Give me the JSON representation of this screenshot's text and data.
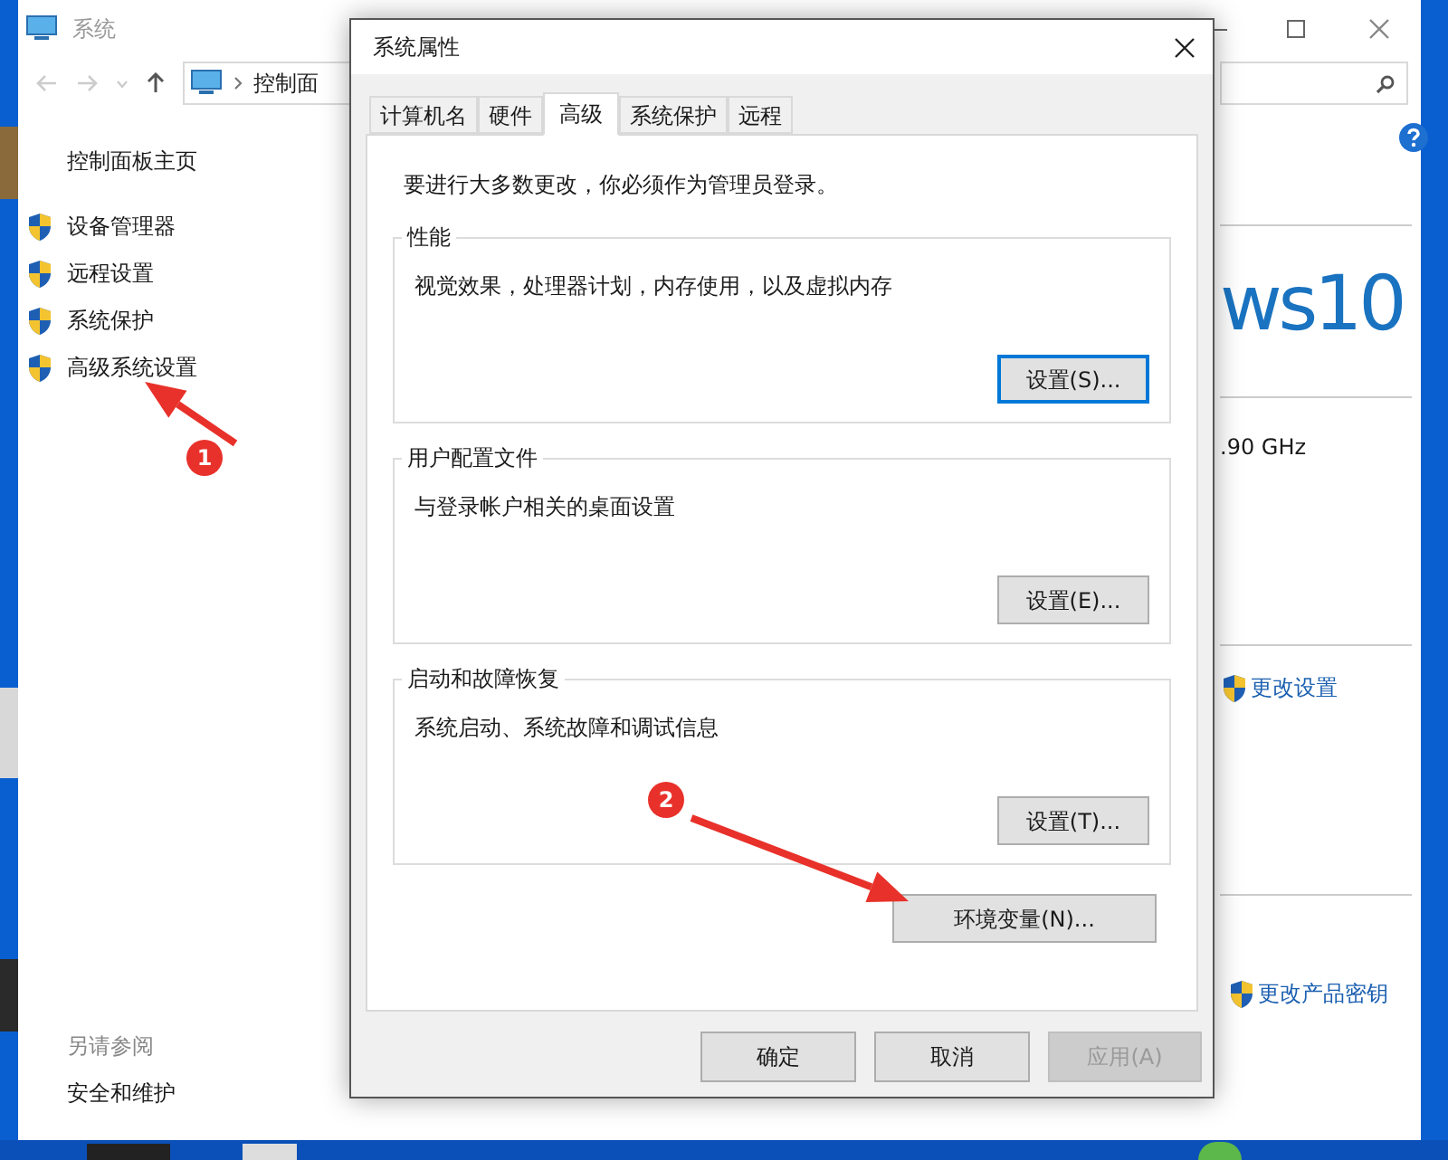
{
  "system_window": {
    "title": "系统",
    "breadcrumb": "控制面",
    "sidebar": {
      "home": "控制面板主页",
      "items": [
        {
          "label": "设备管理器"
        },
        {
          "label": "远程设置"
        },
        {
          "label": "系统保护"
        },
        {
          "label": "高级系统设置"
        }
      ],
      "see_also_title": "另请参阅",
      "see_also": [
        "安全和维护"
      ]
    },
    "edition_logo": "ws10",
    "processor_speed": ".90 GHz",
    "links": [
      {
        "label": "更改设置"
      },
      {
        "label": "更改产品密钥"
      }
    ]
  },
  "dialog": {
    "title": "系统属性",
    "tabs": [
      {
        "label": "计算机名",
        "selected": false
      },
      {
        "label": "硬件",
        "selected": false
      },
      {
        "label": "高级",
        "selected": true
      },
      {
        "label": "系统保护",
        "selected": false
      },
      {
        "label": "远程",
        "selected": false
      }
    ],
    "admin_note": "要进行大多数更改，你必须作为管理员登录。",
    "groups": [
      {
        "title": "性能",
        "description": "视觉效果，处理器计划，内存使用，以及虚拟内存",
        "button": "设置(S)...",
        "focused": true
      },
      {
        "title": "用户配置文件",
        "description": "与登录帐户相关的桌面设置",
        "button": "设置(E)...",
        "focused": false
      },
      {
        "title": "启动和故障恢复",
        "description": "系统启动、系统故障和调试信息",
        "button": "设置(T)...",
        "focused": false
      }
    ],
    "env_button": "环境变量(N)...",
    "buttons": [
      {
        "label": "确定",
        "disabled": false
      },
      {
        "label": "取消",
        "disabled": false
      },
      {
        "label": "应用(A)",
        "disabled": true
      }
    ]
  },
  "annotations": [
    {
      "number": "1"
    },
    {
      "number": "2"
    }
  ]
}
